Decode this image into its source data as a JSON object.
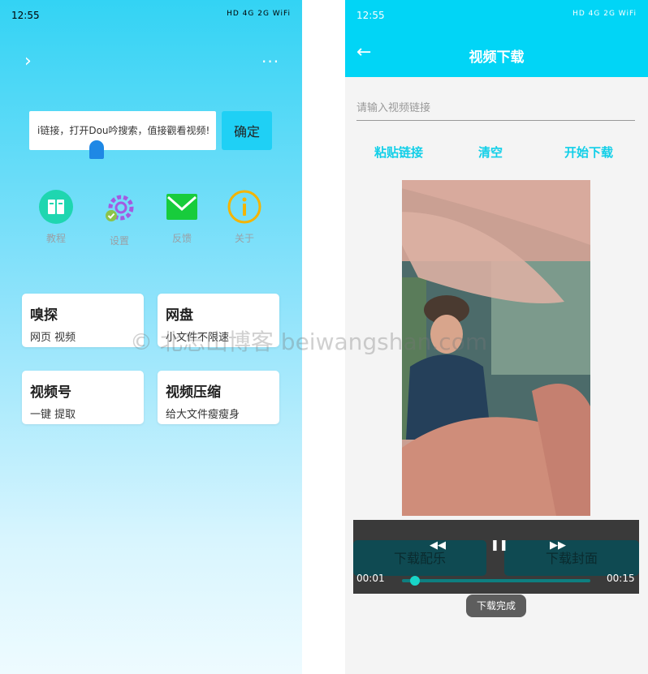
{
  "left": {
    "status": {
      "time": "12:55",
      "icons": "HD 4G 2G WiFi"
    },
    "nav": {
      "chevron": "›",
      "more": "···"
    },
    "url_text": "i链接，打开Dou吟搜索，值接觀看视频!",
    "confirm_label": "确定",
    "quick_icons": [
      {
        "label": "教程",
        "icon": "book-icon",
        "color": "#1fd6b0"
      },
      {
        "label": "设置",
        "icon": "gear-icon",
        "color": "#a35be0"
      },
      {
        "label": "反馈",
        "icon": "mail-icon",
        "color": "#18cc3c"
      },
      {
        "label": "关于",
        "icon": "info-icon",
        "color": "#f4b400"
      }
    ],
    "cards": [
      {
        "title": "嗅探",
        "sub": "网页 视频"
      },
      {
        "title": "网盘",
        "sub": "小文件不限速"
      },
      {
        "title": "视频号",
        "sub": "一键 提取"
      },
      {
        "title": "视频压缩",
        "sub": "给大文件瘦瘦身"
      }
    ]
  },
  "right": {
    "status": {
      "time": "12:55",
      "icons": "HD 4G 2G WiFi"
    },
    "title": "视频下载",
    "back": "←",
    "input_placeholder": "请输入视频链接",
    "actions": {
      "paste": "粘贴链接",
      "clear": "清空",
      "start": "开始下载"
    },
    "player": {
      "rewind": "◀◀",
      "pause": "❚❚",
      "forward": "▶▶",
      "time_current": "00:01",
      "time_total": "00:15",
      "progress": 0.07,
      "download_music": "下载配乐",
      "download_cover": "下载封面"
    },
    "toast": "下载完成"
  },
  "watermark": "© 北忘山博客 beiwangshan.com"
}
